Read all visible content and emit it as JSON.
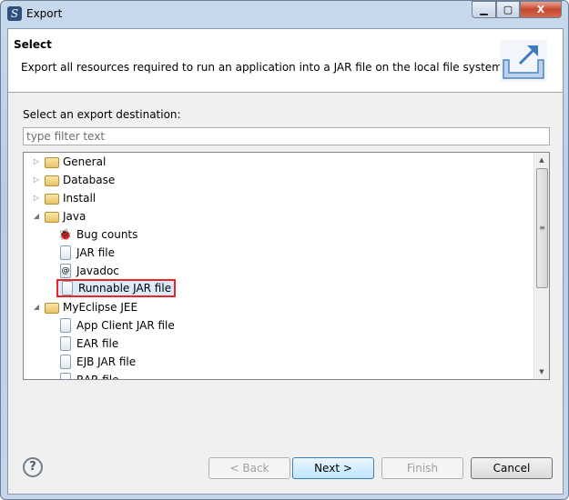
{
  "window": {
    "title": "Export",
    "controls": [
      "minimize",
      "maximize",
      "close"
    ]
  },
  "header": {
    "title": "Select",
    "description": "Export all resources required to run an application into a JAR file on the local file system.",
    "icon": "export-icon"
  },
  "destination_label": "Select an export destination:",
  "filter": {
    "value": "",
    "placeholder": "type filter text"
  },
  "tree": [
    {
      "label": "General",
      "level": 0,
      "expanded": false,
      "icon": "folder-icon"
    },
    {
      "label": "Database",
      "level": 0,
      "expanded": false,
      "icon": "folder-icon"
    },
    {
      "label": "Install",
      "level": 0,
      "expanded": false,
      "icon": "folder-icon"
    },
    {
      "label": "Java",
      "level": 0,
      "expanded": true,
      "icon": "folder-icon"
    },
    {
      "label": "Bug counts",
      "level": 1,
      "icon": "bug-icon"
    },
    {
      "label": "JAR file",
      "level": 1,
      "icon": "jar-icon"
    },
    {
      "label": "Javadoc",
      "level": 1,
      "icon": "javadoc-icon"
    },
    {
      "label": "Runnable JAR file",
      "level": 1,
      "icon": "runnable-jar-icon",
      "selected": true,
      "highlight_color": "#e8262a"
    },
    {
      "label": "MyEclipse JEE",
      "level": 0,
      "expanded": true,
      "icon": "folder-icon"
    },
    {
      "label": "App Client JAR file",
      "level": 1,
      "icon": "app-client-jar-icon"
    },
    {
      "label": "EAR file",
      "level": 1,
      "icon": "ear-icon"
    },
    {
      "label": "EJB JAR file",
      "level": 1,
      "icon": "ejb-jar-icon"
    },
    {
      "label": "RAR file",
      "level": 1,
      "icon": "rar-icon"
    }
  ],
  "buttons": {
    "back": "< Back",
    "next": "Next >",
    "finish": "Finish",
    "cancel": "Cancel",
    "help": "?"
  }
}
